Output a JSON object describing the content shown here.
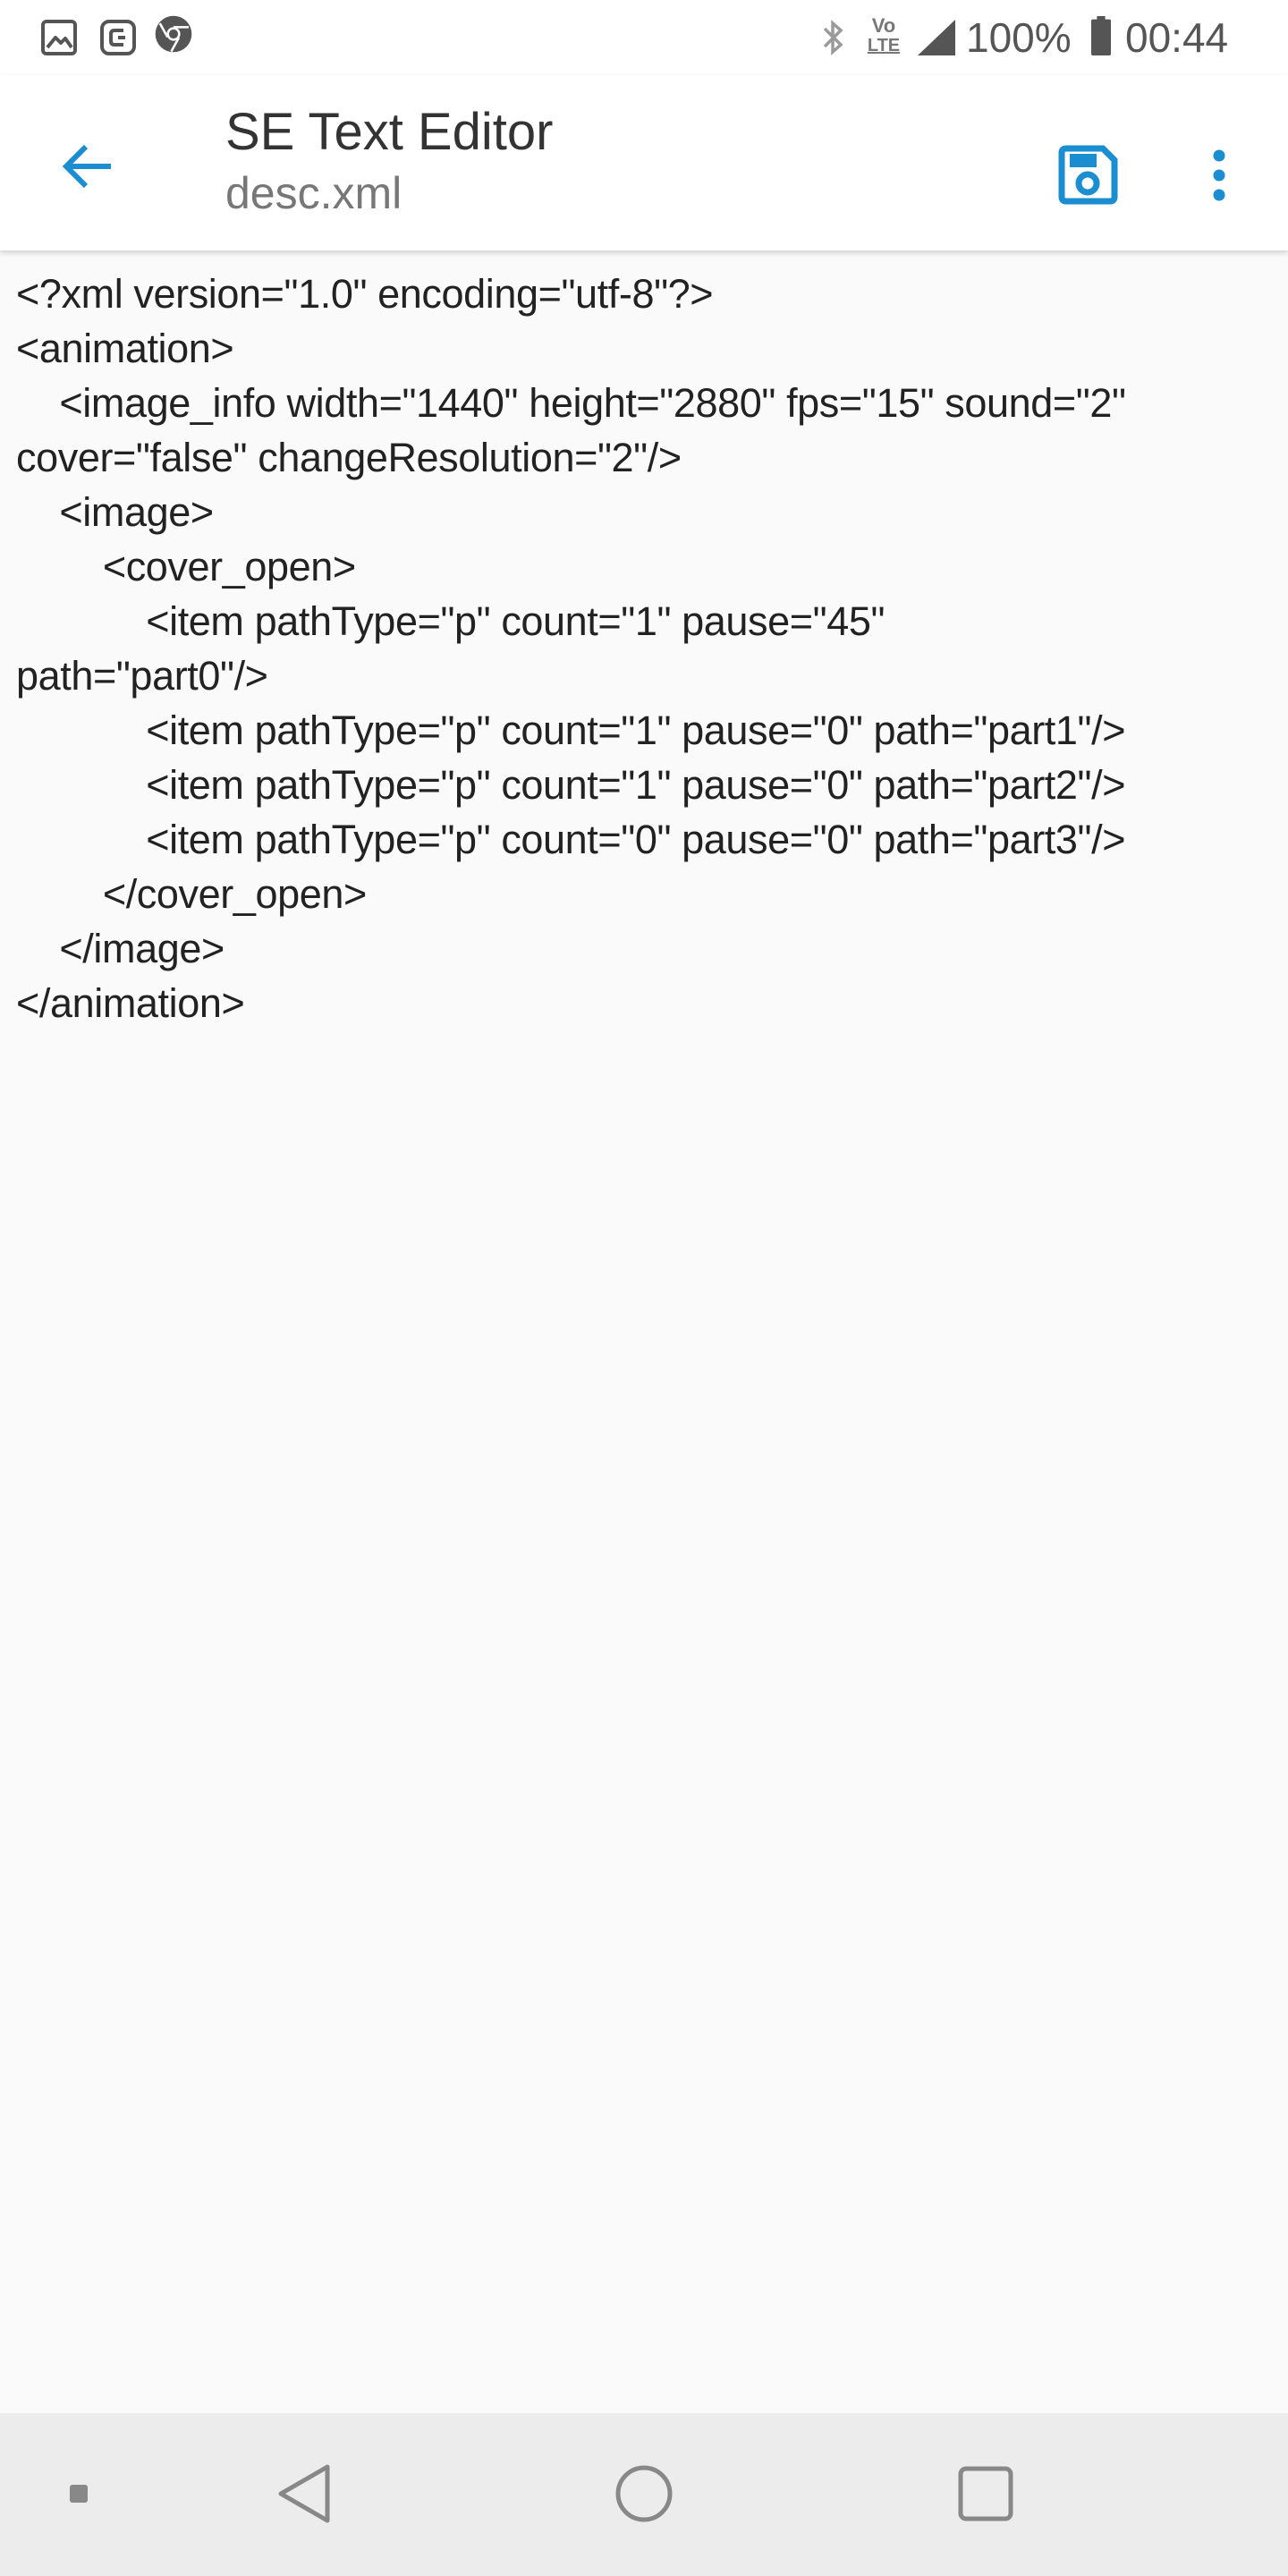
{
  "status_bar": {
    "battery_percent": "100%",
    "time": "00:44",
    "network_label_top": "Vo",
    "network_label_bottom": "LTE",
    "left_icons": [
      "gallery-icon",
      "screenshot-app-icon",
      "browser-icon"
    ],
    "right_icons": [
      "bluetooth-icon",
      "volte-icon",
      "signal-icon",
      "battery-icon"
    ]
  },
  "app_bar": {
    "title": "SE Text Editor",
    "subtitle": "desc.xml",
    "accent_color": "#1a8ed1",
    "icons": [
      "back-arrow-icon",
      "save-icon",
      "more-vert-icon"
    ]
  },
  "editor": {
    "lines": [
      "<?xml version=\"1.0\" encoding=\"utf-8\"?>",
      "<animation>",
      "    <image_info width=\"1440\" height=\"2880\" fps=\"15\" sound=\"2\"",
      "cover=\"false\" changeResolution=\"2\"/>",
      "    <image>",
      "        <cover_open>",
      "            <item pathType=\"p\" count=\"1\" pause=\"45\"",
      "path=\"part0\"/>",
      "            <item pathType=\"p\" count=\"1\" pause=\"0\" path=\"part1\"/>",
      "            <item pathType=\"p\" count=\"1\" pause=\"0\" path=\"part2\"/>",
      "            <item pathType=\"p\" count=\"0\" pause=\"0\" path=\"part3\"/>",
      "        </cover_open>",
      "    </image>",
      "</animation>"
    ]
  },
  "nav_bar": {
    "icons": [
      "dot-icon",
      "back-triangle-icon",
      "home-circle-icon",
      "recents-square-icon"
    ]
  }
}
